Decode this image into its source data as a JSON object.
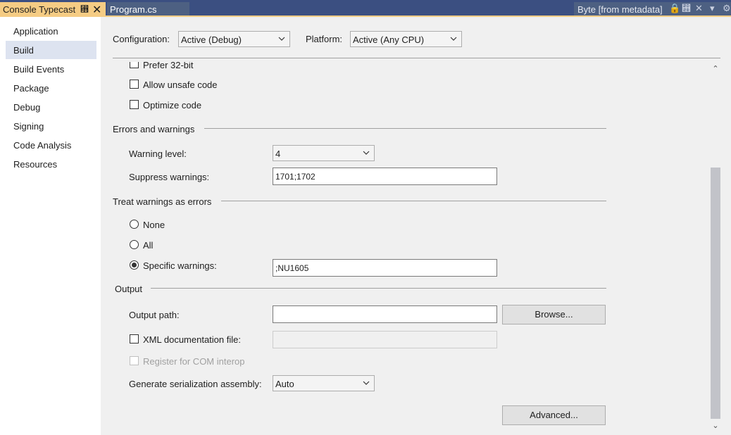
{
  "tabs": {
    "active": {
      "label": "Console Typecast",
      "pin_glyph": "⴫",
      "close_glyph": "✕"
    },
    "second": {
      "label": "Program.cs"
    },
    "right": {
      "label": "Byte [from metadata]"
    }
  },
  "nav": {
    "items": [
      {
        "label": "Application"
      },
      {
        "label": "Build",
        "selected": true
      },
      {
        "label": "Build Events"
      },
      {
        "label": "Package"
      },
      {
        "label": "Debug"
      },
      {
        "label": "Signing"
      },
      {
        "label": "Code Analysis"
      },
      {
        "label": "Resources"
      }
    ]
  },
  "config": {
    "configuration_label": "Configuration:",
    "configuration_value": "Active (Debug)",
    "platform_label": "Platform:",
    "platform_value": "Active (Any CPU)"
  },
  "general": {
    "prefer32": "Prefer 32-bit",
    "allow_unsafe": "Allow unsafe code",
    "optimize": "Optimize code"
  },
  "errors": {
    "section": "Errors and warnings",
    "warning_level_label": "Warning level:",
    "warning_level_value": "4",
    "suppress_label": "Suppress warnings:",
    "suppress_value": "1701;1702"
  },
  "treat": {
    "section": "Treat warnings as errors",
    "none": "None",
    "all": "All",
    "specific": "Specific warnings:",
    "specific_value": ";NU1605",
    "selected": "specific"
  },
  "output": {
    "section": "Output",
    "path_label": "Output path:",
    "path_value": "",
    "browse": "Browse...",
    "xml_doc": "XML documentation file:",
    "com_interop": "Register for COM interop",
    "serialization_label": "Generate serialization assembly:",
    "serialization_value": "Auto",
    "advanced": "Advanced..."
  },
  "colors": {
    "tab_bar": "#3b4f81",
    "active_tab": "#f5cc84",
    "nav_selected": "#dde3f0"
  }
}
